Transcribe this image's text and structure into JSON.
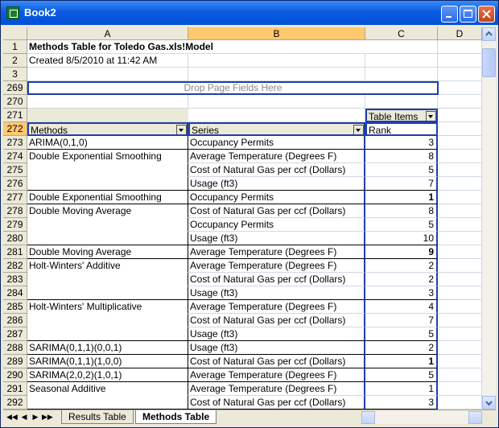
{
  "window": {
    "title": "Book2"
  },
  "columns": [
    "A",
    "B",
    "C",
    "D"
  ],
  "top_rows": [
    {
      "num": "1",
      "a": "Methods Table for Toledo Gas.xls!Model"
    },
    {
      "num": "2",
      "a": "Created 8/5/2010 at 11:42 AM"
    },
    {
      "num": "3",
      "a": ""
    },
    {
      "num": "269",
      "drop": "Drop Page Fields Here"
    },
    {
      "num": "270",
      "a": ""
    },
    {
      "num": "271",
      "c": "Table Items"
    },
    {
      "num": "272",
      "a": "Methods",
      "b": "Series",
      "c": "Rank"
    }
  ],
  "rows": [
    {
      "num": "273",
      "method": "ARIMA(0,1,0)",
      "series": "Occupancy Permits",
      "rank": "3"
    },
    {
      "num": "274",
      "method": "Double Exponential Smoothing",
      "series": "Average Temperature (Degrees F)",
      "rank": "8"
    },
    {
      "num": "275",
      "method": "",
      "series": "Cost of Natural Gas per ccf (Dollars)",
      "rank": "5"
    },
    {
      "num": "276",
      "method": "",
      "series": "Usage (ft3)",
      "rank": "7"
    },
    {
      "num": "277",
      "method": "Double Exponential Smoothing",
      "series": "Occupancy Permits",
      "rank": "1"
    },
    {
      "num": "278",
      "method": "Double Moving Average",
      "series": "Cost of Natural Gas per ccf (Dollars)",
      "rank": "8"
    },
    {
      "num": "279",
      "method": "",
      "series": "Occupancy Permits",
      "rank": "5"
    },
    {
      "num": "280",
      "method": "",
      "series": "Usage (ft3)",
      "rank": "10"
    },
    {
      "num": "281",
      "method": "Double Moving Average",
      "series": "Average Temperature (Degrees F)",
      "rank": "9"
    },
    {
      "num": "282",
      "method": "Holt-Winters' Additive",
      "series": "Average Temperature (Degrees F)",
      "rank": "2"
    },
    {
      "num": "283",
      "method": "",
      "series": "Cost of Natural Gas per ccf (Dollars)",
      "rank": "2"
    },
    {
      "num": "284",
      "method": "",
      "series": "Usage (ft3)",
      "rank": "3"
    },
    {
      "num": "285",
      "method": "Holt-Winters' Multiplicative",
      "series": "Average Temperature (Degrees F)",
      "rank": "4"
    },
    {
      "num": "286",
      "method": "",
      "series": "Cost of Natural Gas per ccf (Dollars)",
      "rank": "7"
    },
    {
      "num": "287",
      "method": "",
      "series": "Usage (ft3)",
      "rank": "5"
    },
    {
      "num": "288",
      "method": "SARIMA(0,1,1)(0,0,1)",
      "series": "Usage (ft3)",
      "rank": "2"
    },
    {
      "num": "289",
      "method": "SARIMA(0,1,1)(1,0,0)",
      "series": "Cost of Natural Gas per ccf (Dollars)",
      "rank": "1"
    },
    {
      "num": "290",
      "method": "SARIMA(2,0,2)(1,0,1)",
      "series": "Average Temperature (Degrees F)",
      "rank": "5"
    },
    {
      "num": "291",
      "method": "Seasonal Additive",
      "series": "Average Temperature (Degrees F)",
      "rank": "1"
    },
    {
      "num": "292",
      "method": "",
      "series": "Cost of Natural Gas per ccf (Dollars)",
      "rank": "3"
    }
  ],
  "tabs": [
    "Results Table",
    "Methods Table"
  ],
  "active_tab": "Methods Table"
}
